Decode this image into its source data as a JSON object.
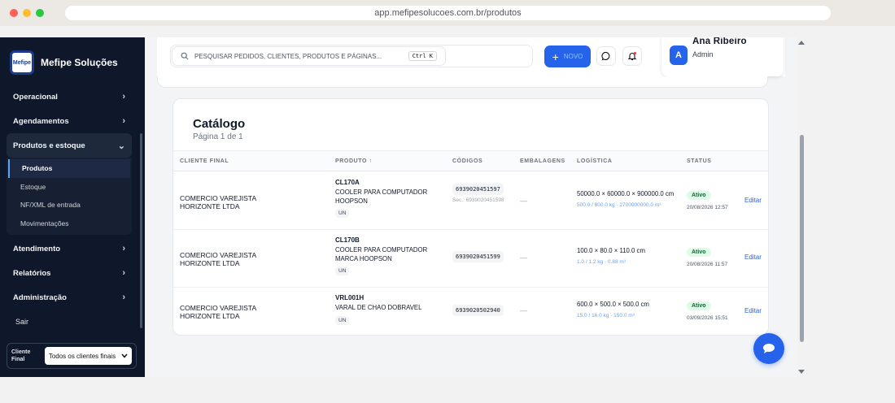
{
  "browser": {
    "url": "app.mefipesolucoes.com.br/produtos"
  },
  "sidebar": {
    "brand": "Mefipe Soluções",
    "logo_text": "Mefipe",
    "items": [
      {
        "label": "Operacional"
      },
      {
        "label": "Agendamentos"
      },
      {
        "label": "Produtos e estoque"
      },
      {
        "label": "Atendimento"
      },
      {
        "label": "Relatórios"
      },
      {
        "label": "Administração"
      }
    ],
    "subitems": [
      {
        "label": "Produtos"
      },
      {
        "label": "Estoque"
      },
      {
        "label": "NF/XML de entrada"
      },
      {
        "label": "Movimentações"
      }
    ],
    "logout": "Sair",
    "client_filter": {
      "label": "Cliente Final",
      "value": "Todos os clientes finais"
    }
  },
  "topbar": {
    "search_placeholder": "PESQUISAR PEDIDOS, CLIENTES, PRODUTOS E PÁGINAS...",
    "search_shortcut": "Ctrl K",
    "new_label": "NOVO"
  },
  "user": {
    "initial": "A",
    "name": "Ana Ribeiro",
    "role": "Admin"
  },
  "catalog": {
    "title": "Catálogo",
    "subtitle": "Página 1 de 1",
    "columns": [
      "CLIENTE FINAL",
      "PRODUTO ↑",
      "CÓDIGOS",
      "EMBALAGENS",
      "LOGÍSTICA",
      "STATUS"
    ],
    "rows": [
      {
        "client": "COMERCIO VAREJISTA HORIZONTE LTDA",
        "code": "CL170A",
        "desc": "COOLER PARA COMPUTADOR HOOPSON",
        "unit": "UN",
        "ean": "6939020451597",
        "secondary": "Sec.: 6939020451598",
        "packaging": "—",
        "dims": "50000.0 × 60000.0 × 900000.0 cm",
        "dims_sub": "500.0 / 800.0 kg · 2700000000.0 m³",
        "status": "Ativo",
        "date": "20/08/2026 12:57",
        "action": "Editar"
      },
      {
        "client": "COMERCIO VAREJISTA HORIZONTE LTDA",
        "code": "CL170B",
        "desc": "COOLER PARA COMPUTADOR MARCA HOOPSON",
        "unit": "UN",
        "ean": "6939020451599",
        "secondary": "",
        "packaging": "—",
        "dims": "100.0 × 80.0 × 110.0 cm",
        "dims_sub": "1.0 / 1.2 kg · 0.88 m³",
        "status": "Ativo",
        "date": "20/08/2026 11:57",
        "action": "Editar"
      },
      {
        "client": "COMERCIO VAREJISTA HORIZONTE LTDA",
        "code": "VRL001H",
        "desc": "VARAL DE CHAO DOBRAVEL",
        "unit": "UN",
        "ean": "6939020502940",
        "secondary": "",
        "packaging": "—",
        "dims": "600.0 × 500.0 × 500.0 cm",
        "dims_sub": "15.0 / 16.0 kg · 150.0 m³",
        "status": "Ativo",
        "date": "03/09/2026 15:51",
        "action": "Editar"
      }
    ]
  },
  "colors": {
    "accent": "#2563eb",
    "sidebar": "#0f172a",
    "active_badge": "#dcfce7"
  }
}
